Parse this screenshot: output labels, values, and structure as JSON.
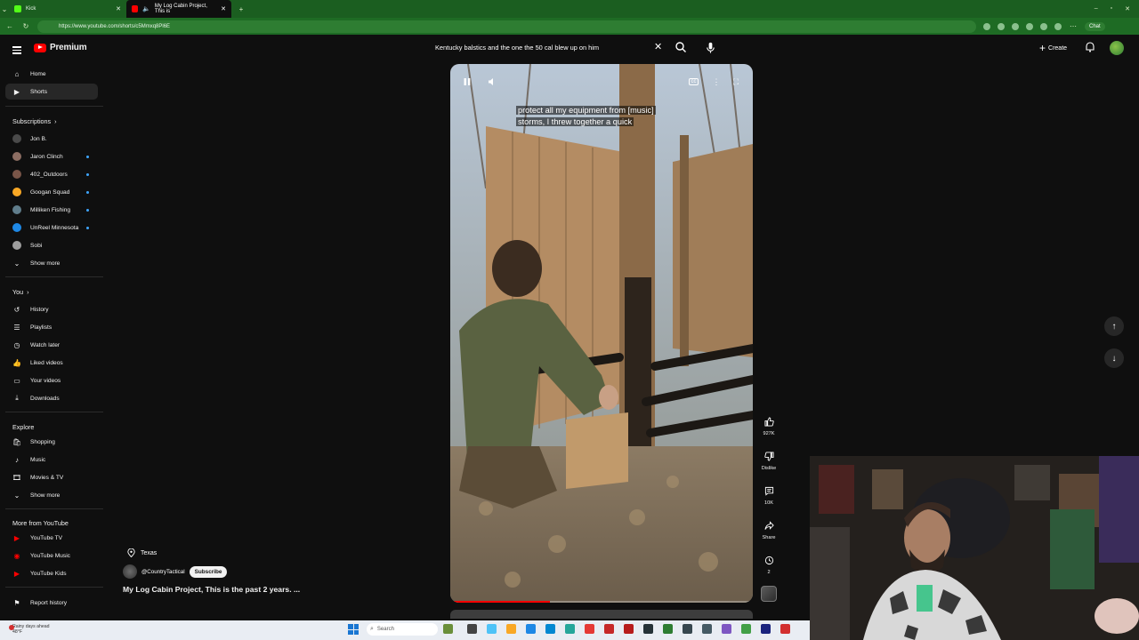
{
  "browser": {
    "tabs": [
      {
        "label": "Kick",
        "active": false,
        "favicon_color": "#53fc18"
      },
      {
        "label": "My Log Cabin Project, This is",
        "active": true,
        "favicon_color": "#ff0000"
      }
    ],
    "url": "https://www.youtube.com/shorts/c5Mmxq8Pl6E",
    "chat_label": "Chat"
  },
  "header": {
    "logo_label": "Premium",
    "search_value": "Kentucky balstics and the one the 50 cal blew up on him",
    "create_label": "Create"
  },
  "sidebar": {
    "main": [
      {
        "label": "Home",
        "icon": "home-icon"
      },
      {
        "label": "Shorts",
        "icon": "shorts-icon",
        "active": true
      }
    ],
    "subscriptions_title": "Subscriptions",
    "subscriptions": [
      {
        "label": "Jon B.",
        "color": "#4a4a4a",
        "live": false
      },
      {
        "label": "Jaron Clinch",
        "color": "#8d6e63",
        "live": true
      },
      {
        "label": "402_Outdoors",
        "color": "#795548",
        "live": true
      },
      {
        "label": "Googan Squad",
        "color": "#f9a825",
        "live": true
      },
      {
        "label": "Milliken Fishing",
        "color": "#607d8b",
        "live": true
      },
      {
        "label": "UnReel Minnesota",
        "color": "#1e88e5",
        "live": true
      },
      {
        "label": "Sobi",
        "color": "#9e9e9e",
        "live": false
      }
    ],
    "show_more_1": "Show more",
    "you_title": "You",
    "you_items": [
      {
        "label": "History",
        "icon": "history-icon"
      },
      {
        "label": "Playlists",
        "icon": "playlists-icon"
      },
      {
        "label": "Watch later",
        "icon": "watch-later-icon"
      },
      {
        "label": "Liked videos",
        "icon": "thumbs-up-icon"
      },
      {
        "label": "Your videos",
        "icon": "your-videos-icon"
      },
      {
        "label": "Downloads",
        "icon": "download-icon"
      }
    ],
    "explore_title": "Explore",
    "explore_items": [
      {
        "label": "Shopping",
        "icon": "shopping-icon"
      },
      {
        "label": "Music",
        "icon": "music-icon"
      },
      {
        "label": "Movies & TV",
        "icon": "movies-icon"
      }
    ],
    "show_more_2": "Show more",
    "more_title": "More from YouTube",
    "more_items": [
      {
        "label": "YouTube TV",
        "icon": "youtube-tv-icon"
      },
      {
        "label": "YouTube Music",
        "icon": "youtube-music-icon"
      },
      {
        "label": "YouTube Kids",
        "icon": "youtube-kids-icon"
      }
    ],
    "report_label": "Report history"
  },
  "short": {
    "caption_line1": "protect all my equipment from [music]",
    "caption_line2": "storms, I threw together a quick",
    "progress": 0.33,
    "location": "Texas",
    "channel_handle": "@CountryTactical",
    "subscribe_label": "Subscribe",
    "title": "My Log Cabin Project, This is the past 2 years. ..."
  },
  "actions": {
    "like_count": "927K",
    "dislike_label": "Dislike",
    "comment_count": "10K",
    "share_label": "Share",
    "remix_count": "2"
  },
  "taskbar": {
    "weather_line1": "Rainy days ahead",
    "weather_line2": "48°F",
    "search_placeholder": "Search"
  }
}
